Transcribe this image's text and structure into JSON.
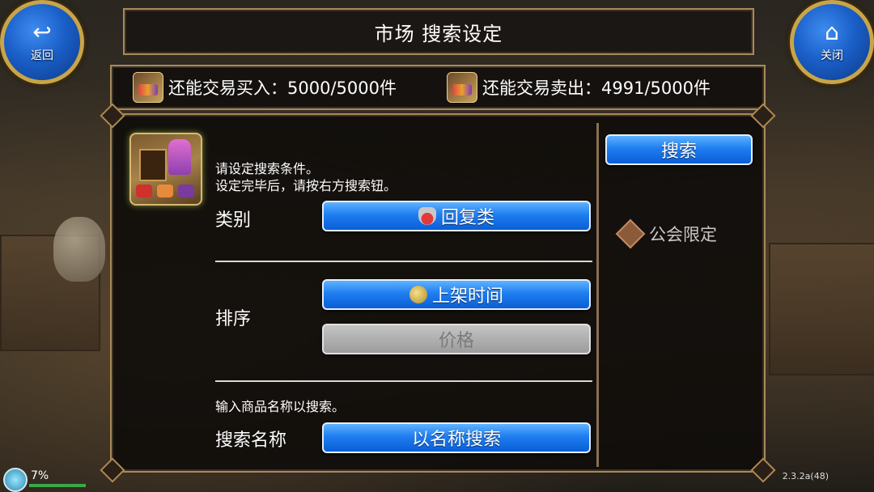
{
  "header": {
    "title": "市场 搜索设定",
    "back_label": "返回",
    "close_label": "关闭"
  },
  "quota": {
    "buy_text": "还能交易买入：5000/5000件",
    "sell_text": "还能交易卖出：4991/5000件"
  },
  "panel": {
    "instruction_line1": "请设定搜索条件。",
    "instruction_line2": "设定完毕后，请按右方搜索钮。",
    "category_label": "类别",
    "category_value": "回复类",
    "sort_label": "排序",
    "sort_options": [
      "上架时间",
      "价格"
    ],
    "name_prompt": "输入商品名称以搜索。",
    "name_label": "搜索名称",
    "name_button": "以名称搜索",
    "search_button": "搜索",
    "guild_limit": "公会限定"
  },
  "status": {
    "percent": "7%",
    "version": "2.3.2a(48)"
  },
  "colors": {
    "button_blue": "#1f7ef0",
    "button_gray": "#9c9c9c",
    "frame_gold": "#a88a5a"
  },
  "icons": {
    "back": "back-arrow-icon",
    "close": "home-icon",
    "category": "potion-icon",
    "sort_time": "coin-icon",
    "guild": "diamond-icon"
  }
}
